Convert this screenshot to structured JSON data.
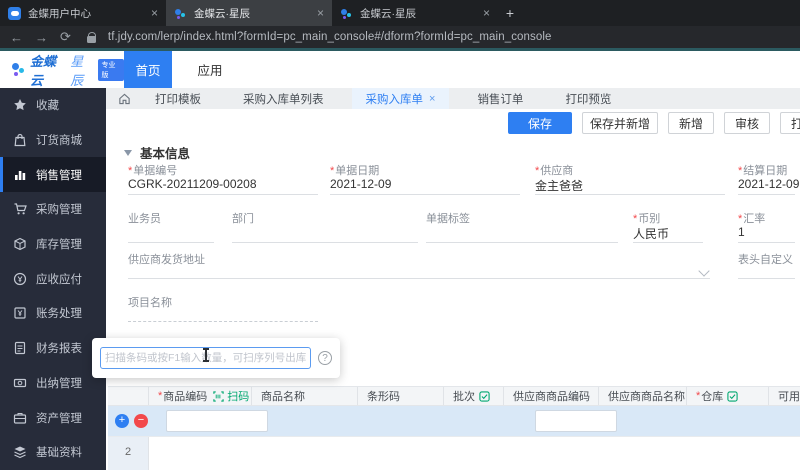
{
  "marks": {
    "required": "*"
  },
  "browser": {
    "tabs": [
      {
        "title": "金蝶用户中心"
      },
      {
        "title": "金蝶云·星辰"
      },
      {
        "title": "金蝶云·星辰"
      }
    ],
    "close_glyph": "×",
    "new_tab_glyph": "+",
    "back_glyph": "←",
    "forward_glyph": "→",
    "reload_glyph": "⟳",
    "url": "tf.jdy.com/lerp/index.html?formId=pc_main_console#/dform?formId=pc_main_console"
  },
  "header": {
    "logo_primary": "金蝶云",
    "logo_secondary": "星辰",
    "logo_badge": "专业版",
    "nav_home": "首页",
    "nav_apps": "应用"
  },
  "sidebar": {
    "items": [
      {
        "label": "收藏"
      },
      {
        "label": "订货商城"
      },
      {
        "label": "销售管理"
      },
      {
        "label": "采购管理"
      },
      {
        "label": "库存管理"
      },
      {
        "label": "应收应付"
      },
      {
        "label": "账务处理"
      },
      {
        "label": "财务报表"
      },
      {
        "label": "出纳管理"
      },
      {
        "label": "资产管理"
      },
      {
        "label": "基础资料"
      }
    ]
  },
  "tabbar": {
    "tabs": [
      {
        "label": "打印模板"
      },
      {
        "label": "采购入库单列表"
      },
      {
        "label": "采购入库单"
      },
      {
        "label": "销售订单"
      },
      {
        "label": "打印预览"
      }
    ],
    "close_glyph": "×"
  },
  "toolbar": {
    "save": "保存",
    "save_new": "保存并新增",
    "add": "新增",
    "audit": "审核",
    "print": "打印"
  },
  "form": {
    "section_title": "基本信息",
    "fields": {
      "doc_no": {
        "label": "单据编号",
        "value": "CGRK-20211209-00208"
      },
      "doc_date": {
        "label": "单据日期",
        "value": "2021-12-09"
      },
      "supplier": {
        "label": "供应商",
        "value": "金主爸爸"
      },
      "settle_date": {
        "label": "结算日期",
        "value": "2021-12-09"
      },
      "salesperson": {
        "label": "业务员",
        "value": ""
      },
      "department": {
        "label": "部门",
        "value": ""
      },
      "doc_tag": {
        "label": "单据标签",
        "value": ""
      },
      "currency": {
        "label": "币别",
        "value": "人民币"
      },
      "exchange_rate": {
        "label": "汇率",
        "value": "1"
      },
      "supplier_address": {
        "label": "供应商发货地址",
        "value": ""
      },
      "header_custom": {
        "label": "表头自定义",
        "value": ""
      },
      "project_name": {
        "label": "项目名称",
        "value": ""
      }
    }
  },
  "scan_popup": {
    "placeholder": "扫描条码或按F1输入数量，可扫序列号出库",
    "help_glyph": "?"
  },
  "grid": {
    "scan_link": "扫码",
    "columns": {
      "product_code": {
        "label": "商品编码"
      },
      "product_name": {
        "label": "商品名称"
      },
      "barcode": {
        "label": "条形码"
      },
      "batch": {
        "label": "批次"
      },
      "supplier_product_code": {
        "label": "供应商商品编码"
      },
      "supplier_product_name": {
        "label": "供应商商品名称"
      },
      "warehouse": {
        "label": "仓库"
      },
      "available_stock": {
        "label": "可用库存"
      }
    },
    "row2_number": "2",
    "add_glyph": "+",
    "remove_glyph": "−"
  }
}
